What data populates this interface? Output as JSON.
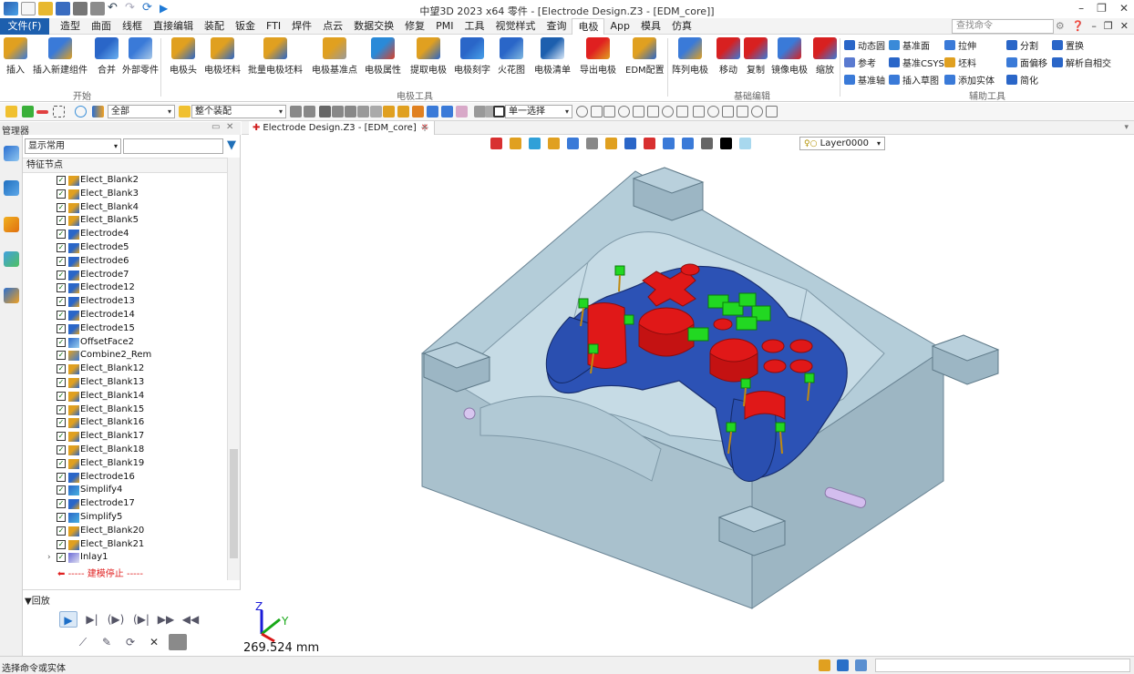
{
  "titlebar": {
    "title": "中望3D 2023 x64      零件 - [Electrode Design.Z3 - [EDM_core]]",
    "win_minimize": "–",
    "win_restore": "❐",
    "win_close": "✕"
  },
  "menubar": {
    "file_label": "文件(F)",
    "tabs": [
      "造型",
      "曲面",
      "线框",
      "直接编辑",
      "装配",
      "钣金",
      "FTI",
      "焊件",
      "点云",
      "数据交换",
      "修复",
      "PMI",
      "工具",
      "视觉样式",
      "查询",
      "电极",
      "App",
      "模具",
      "仿真"
    ],
    "active_tab": "电极",
    "search_placeholder": "查找命令"
  },
  "ribbon": {
    "groups": [
      "开始",
      "电极工具",
      "基础编辑",
      "辅助工具"
    ],
    "buttons": [
      "插入",
      "插入新建组件",
      "合并",
      "外部零件",
      "电极头",
      "电极坯料",
      "批量电极坯料",
      "电极基准点",
      "电极属性",
      "提取电极",
      "电极刻字",
      "火花图",
      "电极清单",
      "导出电极",
      "EDM配置",
      "阵列电极",
      "移动",
      "复制",
      "镜像电极",
      "缩放"
    ],
    "small_buttons": [
      "动态圆",
      "参考",
      "基准轴",
      "基准面",
      "基准CSYS",
      "插入草图",
      "拉伸",
      "坯料",
      "添加实体",
      "分割",
      "面偏移",
      "简化",
      "置换",
      "解析自相交"
    ]
  },
  "toolbar": {
    "filter_value": "全部",
    "assembly_value": "整个装配",
    "select_mode": "单一选择"
  },
  "manager": {
    "title": "管理器",
    "filter_value": "显示常用",
    "column_header": "特征节点",
    "tree_items": [
      {
        "label": "Elect_Blank2",
        "type": "blank"
      },
      {
        "label": "Elect_Blank3",
        "type": "blank"
      },
      {
        "label": "Elect_Blank4",
        "type": "blank"
      },
      {
        "label": "Elect_Blank5",
        "type": "blank"
      },
      {
        "label": "Electrode4",
        "type": "electrode"
      },
      {
        "label": "Electrode5",
        "type": "electrode"
      },
      {
        "label": "Electrode6",
        "type": "electrode"
      },
      {
        "label": "Electrode7",
        "type": "electrode"
      },
      {
        "label": "Electrode12",
        "type": "electrode"
      },
      {
        "label": "Electrode13",
        "type": "electrode"
      },
      {
        "label": "Electrode14",
        "type": "electrode"
      },
      {
        "label": "Electrode15",
        "type": "electrode"
      },
      {
        "label": "OffsetFace2",
        "type": "offset"
      },
      {
        "label": "Combine2_Rem",
        "type": "combine"
      },
      {
        "label": "Elect_Blank12",
        "type": "blank"
      },
      {
        "label": "Elect_Blank13",
        "type": "blank"
      },
      {
        "label": "Elect_Blank14",
        "type": "blank"
      },
      {
        "label": "Elect_Blank15",
        "type": "blank"
      },
      {
        "label": "Elect_Blank16",
        "type": "blank"
      },
      {
        "label": "Elect_Blank17",
        "type": "blank"
      },
      {
        "label": "Elect_Blank18",
        "type": "blank"
      },
      {
        "label": "Elect_Blank19",
        "type": "blank"
      },
      {
        "label": "Electrode16",
        "type": "electrode"
      },
      {
        "label": "Simplify4",
        "type": "simplify"
      },
      {
        "label": "Electrode17",
        "type": "electrode"
      },
      {
        "label": "Simplify5",
        "type": "simplify"
      },
      {
        "label": "Elect_Blank20",
        "type": "blank"
      },
      {
        "label": "Elect_Blank21",
        "type": "blank"
      },
      {
        "label": "Inlay1",
        "type": "inlay"
      }
    ],
    "stop_text": "----- 建模停止 -----",
    "playback_title": "▼回放"
  },
  "document": {
    "tab_label": "Electrode Design.Z3 - [EDM_core]",
    "layer": "Layer0000",
    "scale_text": "269.524 mm"
  },
  "axes": {
    "x": "X",
    "y": "Y",
    "z": "Z"
  },
  "status": {
    "message": "选择命令或实体"
  },
  "colors": {
    "accent": "#1d5fae",
    "core": "#b8d0dc",
    "part": "#2b52b8",
    "electrode_red": "#e01818",
    "electrode_green": "#22d822"
  }
}
